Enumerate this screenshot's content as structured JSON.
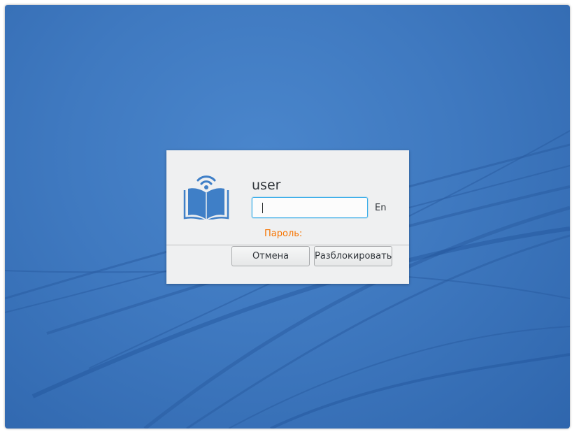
{
  "desktop": {
    "background_color": "#3f79c0"
  },
  "unlock_dialog": {
    "logo_icon": "book-wifi-icon",
    "username": "user",
    "password_value": "",
    "keyboard_layout": "En",
    "password_label": "Пароль:",
    "password_label_color": "#f67400",
    "cancel_label": "Отмена",
    "unlock_label": "Разблокировать"
  }
}
